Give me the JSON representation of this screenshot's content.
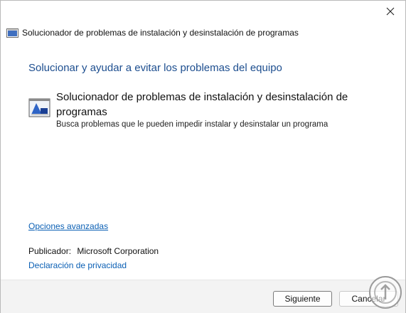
{
  "window": {
    "header_title": "Solucionador de problemas de instalación y desinstalación de programas"
  },
  "main": {
    "heading": "Solucionar y ayudar a evitar los problemas del equipo",
    "tool": {
      "title": "Solucionador de problemas de instalación y desinstalación de programas",
      "description": "Busca problemas que le pueden impedir instalar y desinstalar un programa"
    },
    "advanced_link": "Opciones avanzadas",
    "publisher_label": "Publicador:",
    "publisher_value": "Microsoft Corporation",
    "privacy_link": "Declaración de privacidad"
  },
  "footer": {
    "next_label": "Siguiente",
    "cancel_label": "Cancelar"
  },
  "icons": {
    "close": "close-icon",
    "app": "troubleshooter-icon",
    "tool": "installer-icon",
    "watermark": "watermark-logo"
  },
  "colors": {
    "heading": "#1d4e8f",
    "link": "#0a5fb4",
    "footer_bg": "#f3f3f3"
  }
}
